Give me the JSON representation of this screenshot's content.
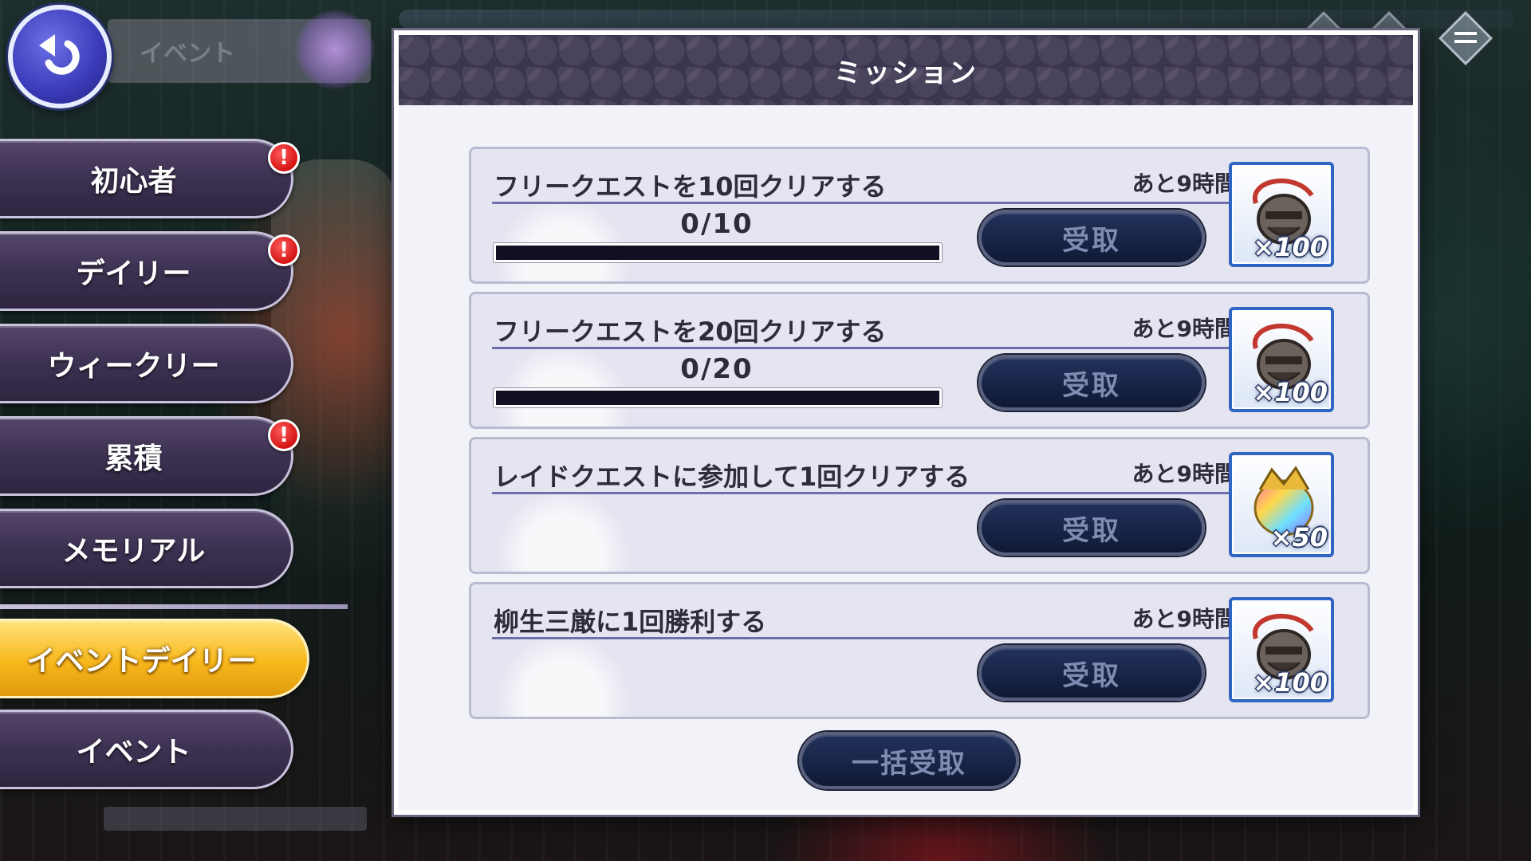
{
  "header": {
    "back_label": "",
    "event_tag": "イベント"
  },
  "sidebar": {
    "items": [
      {
        "label": "初心者",
        "badge": "!"
      },
      {
        "label": "デイリー",
        "badge": "!"
      },
      {
        "label": "ウィークリー",
        "badge": ""
      },
      {
        "label": "累積",
        "badge": "!"
      },
      {
        "label": "メモリアル",
        "badge": ""
      },
      {
        "label": "イベントデイリー",
        "badge": "",
        "active": true
      },
      {
        "label": "イベント",
        "badge": ""
      }
    ]
  },
  "panel": {
    "title": "ミッション",
    "claim_all_label": "一括受取",
    "missions": [
      {
        "title": "フリークエストを10回クリアする",
        "time_left": "あと9時間",
        "progress_text": "0/10",
        "progress_fraction": 0,
        "claim_label": "受取",
        "reward_icon": "stone-mask-icon",
        "reward_qty": "×100"
      },
      {
        "title": "フリークエストを20回クリアする",
        "time_left": "あと9時間",
        "progress_text": "0/20",
        "progress_fraction": 0,
        "claim_label": "受取",
        "reward_icon": "stone-mask-icon",
        "reward_qty": "×100"
      },
      {
        "title": "レイドクエストに参加して1回クリアする",
        "time_left": "あと9時間",
        "progress_text": "",
        "claim_label": "受取",
        "reward_icon": "rainbow-gem-icon",
        "reward_qty": "×50"
      },
      {
        "title": "柳生三厳に1回勝利する",
        "time_left": "あと9時間",
        "progress_text": "",
        "claim_label": "受取",
        "reward_icon": "stone-mask-icon",
        "reward_qty": "×100"
      }
    ]
  },
  "colors": {
    "panel_header": "#3c3550",
    "active_tab": "#f8b81c",
    "claim_button": "#172345",
    "badge": "#d41414"
  }
}
